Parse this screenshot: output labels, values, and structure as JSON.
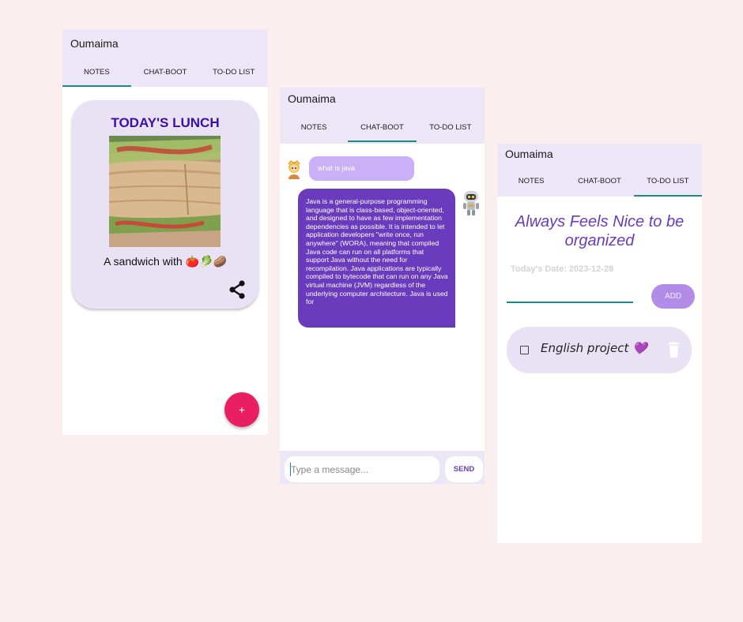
{
  "notes_screen": {
    "app_title": "Oumaima",
    "tabs": [
      "NOTES",
      "CHAT-BOOT",
      "TO-DO LIST"
    ],
    "active_tab": "NOTES",
    "note": {
      "title": "TODAY'S LUNCH",
      "text": "A sandwich with 🍅🥬🥔",
      "share_icon": "share-icon"
    },
    "fab_label": "+",
    "colors": {
      "appbar": "#ece6f6",
      "card": "#e9e2f4",
      "title": "#3b0fa8",
      "fab": "#e91e63",
      "tab_indicator": "#1f8a85"
    }
  },
  "chat_screen": {
    "app_title": "Oumaima",
    "tabs": [
      "NOTES",
      "CHAT-BOOT",
      "TO-DO LIST"
    ],
    "active_tab": "CHAT-BOOT",
    "messages": [
      {
        "sender": "user",
        "text": "what is java"
      },
      {
        "sender": "bot",
        "text": "Java is a general-purpose programming language that is class-based, object-oriented, and designed to have as few implementation dependencies as possible. It is intended to let application developers \"write once, run anywhere\" (WORA), meaning that compiled Java code can run on all platforms that support Java without the need for recompilation. Java applications are typically compiled to bytecode that can run on any Java virtual machine (JVM) regardless of the underlying computer architecture. Java is used for"
      }
    ],
    "input_placeholder": "Type a message...",
    "send_label": "SEND",
    "colors": {
      "user_bubble": "#c9b0f7",
      "bot_bubble": "#6a3bbd"
    }
  },
  "todo_screen": {
    "app_title": "Oumaima",
    "tabs": [
      "NOTES",
      "CHAT-BOOT",
      "TO-DO LIST"
    ],
    "active_tab": "TO-DO LIST",
    "heading": "Always Feels Nice to be organized",
    "date_label": "Today's Date: 2023-12-28",
    "add_label": "ADD",
    "items": [
      {
        "text": "English project 💜",
        "checked": false
      }
    ],
    "colors": {
      "heading": "#6a3bbd",
      "add_button": "#b28ce8"
    }
  }
}
